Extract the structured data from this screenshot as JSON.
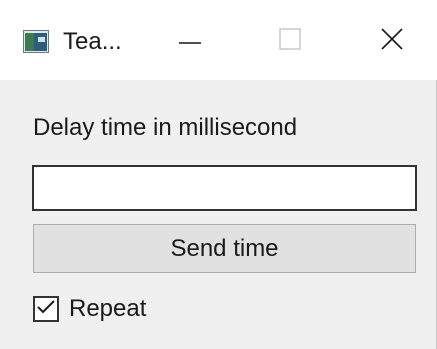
{
  "window": {
    "title": "Tea...",
    "minimize_icon": "minimize-icon",
    "maximize_icon": "maximize-icon",
    "close_icon": "close-icon",
    "app_icon": "app-window-icon"
  },
  "form": {
    "delay_label": "Delay time in millisecond",
    "delay_value": "",
    "delay_placeholder": "",
    "send_button_label": "Send time",
    "repeat_label": "Repeat",
    "repeat_checked": true
  },
  "colors": {
    "titlebar": "#ffffff",
    "background": "#f0f0f0",
    "button_face": "#e1e1e1",
    "button_border": "#adadad"
  }
}
